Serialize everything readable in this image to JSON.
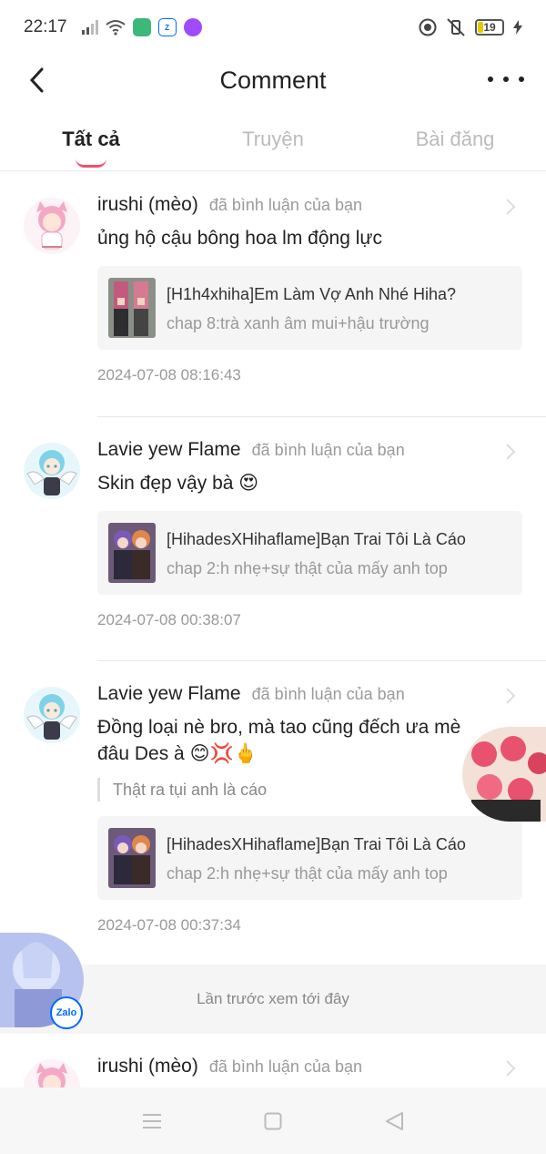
{
  "status": {
    "time": "22:17",
    "battery": "19",
    "icons": [
      "signal-icon",
      "wifi-icon",
      "app-icon-green",
      "zalo-icon",
      "messenger-icon",
      "focus-icon",
      "silent-icon",
      "battery-icon",
      "charging-icon"
    ]
  },
  "nav": {
    "title": "Comment"
  },
  "tabs": [
    {
      "label": "Tất cả"
    },
    {
      "label": "Truyện"
    },
    {
      "label": "Bài đăng"
    }
  ],
  "comments": [
    {
      "user": "irushi (mèo)",
      "action": "đã bình luận của bạn",
      "text": "ủng hộ cậu bông hoa lm động lực",
      "story_title": "[H1h4xhiha]Em Làm Vợ Anh Nhé Hiha?",
      "story_chapter": "chap 8:trà xanh âm mui+hậu trường",
      "time": "2024-07-08 08:16:43"
    },
    {
      "user": "Lavie yew Flame",
      "action": "đã bình luận của bạn",
      "text": "Skin đẹp vậy bà 😍",
      "story_title": "[HihadesXHihaflame]Bạn Trai Tôi Là Cáo",
      "story_chapter": "chap 2:h nhẹ+sự thật của mấy anh top",
      "time": "2024-07-08 00:38:07"
    },
    {
      "user": "Lavie yew Flame",
      "action": "đã bình luận của bạn",
      "text_line1": "Đồng loại nè bro, mà tao cũng đếch ưa mè",
      "text_line2": "đâu Des à 😊💢🖕",
      "quote": "Thật ra tụi anh là cáo",
      "story_title": "[HihadesXHihaflame]Bạn Trai Tôi Là Cáo",
      "story_chapter": "chap 2:h nhẹ+sự thật của mấy anh top",
      "time": "2024-07-08 00:37:34"
    },
    {
      "user": "irushi (mèo)",
      "action": "đã bình luận của bạn"
    }
  ],
  "last_seen": "Lần trước xem tới đây",
  "floating": {
    "zalo_label": "Zalo"
  },
  "colors": {
    "accent": "#f0506e"
  }
}
